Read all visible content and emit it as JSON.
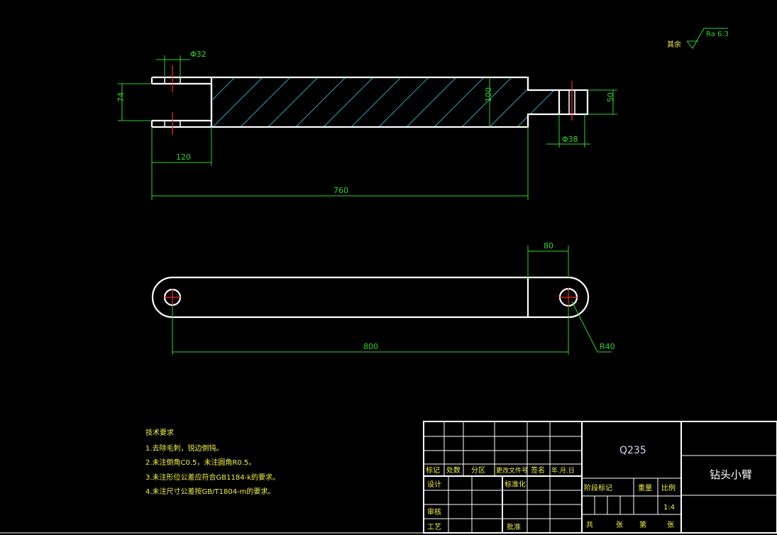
{
  "dims": {
    "hole_dia_left": "Φ32",
    "height_left": "74",
    "length_120": "120",
    "length_760": "760",
    "height_100": "100",
    "height_50": "50",
    "dia_38": "Φ38",
    "width_80": "80",
    "length_800": "800",
    "radius_40": "R40"
  },
  "roughness": {
    "label": "其余",
    "value": "Ra 6.3"
  },
  "tech_requirements": {
    "title": "技术要求",
    "items": [
      "1.去除毛刺，锐边倒钝。",
      "2.未注倒角C0.5，未注圆角R0.5。",
      "3.未注形位公差应符合GB1184-k的要求。",
      "4.未注尺寸公差按GB/T1804-m的要求。"
    ]
  },
  "title_block": {
    "material": "Q235",
    "part_name": "钻头小臂",
    "header_row": [
      "标记",
      "处数",
      "分区",
      "更改文件号",
      "签名",
      "年.月.日"
    ],
    "design": "设计",
    "standardize": "标准化",
    "review": "审核",
    "process": "工艺",
    "approve": "批准",
    "stage_mark": "阶段标记",
    "weight": "重量",
    "scale": "比例",
    "scale_value": "1:4",
    "total": "共",
    "sheets": "张",
    "sheet_no": "第",
    "sheets2": "张"
  }
}
